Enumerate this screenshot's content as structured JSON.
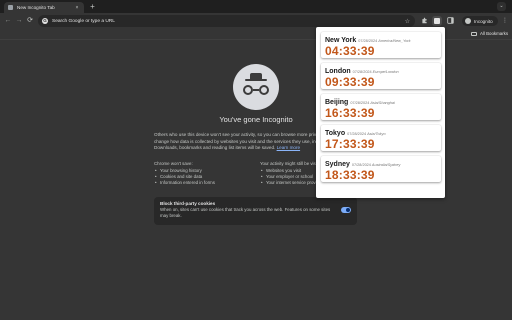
{
  "tabs": [
    {
      "title": "New Incognito Tab",
      "close": "×"
    }
  ],
  "tabstrip": {
    "new_tab": "+",
    "tab_search": "⌄"
  },
  "toolbar": {
    "back": "←",
    "forward": "→",
    "reload": "⟳",
    "omnibox_placeholder": "Search Google or type a URL",
    "google_glyph": "G",
    "star": "☆",
    "profile_label": "Incognito",
    "menu": "⋮"
  },
  "bookmarks": {
    "all_bookmarks": "All Bookmarks"
  },
  "incognito_page": {
    "heading": "You've gone Incognito",
    "intro": "Others who use this device won't see your activity, so you can browse more privately. This won't change how data is collected by websites you visit and the services they use, including Google. Downloads, bookmarks and reading list items will be saved.",
    "learn_more": "Learn more",
    "wont_save": {
      "title": "Chrome won't save:",
      "items": [
        "Your browsing history",
        "Cookies and site data",
        "Information entered in forms"
      ]
    },
    "might_be_visible": {
      "title": "Your activity might still be visible to:",
      "items": [
        "Websites you visit",
        "Your employer or school",
        "Your internet service provider"
      ]
    },
    "cookies": {
      "title": "Block third-party cookies",
      "description": "When on, sites can't use cookies that track you across the web. Features on some sites may break.",
      "enabled": true
    }
  },
  "world_clock": {
    "accent_color": "#c2571a",
    "cities": [
      {
        "name": "New York",
        "date": "07/28/2024",
        "timezone": "America/New_York",
        "time": "04:33:39"
      },
      {
        "name": "London",
        "date": "07/28/2024",
        "timezone": "Europe/London",
        "time": "09:33:39"
      },
      {
        "name": "Beijing",
        "date": "07/28/2024",
        "timezone": "Asia/Shanghai",
        "time": "16:33:39"
      },
      {
        "name": "Tokyo",
        "date": "07/28/2024",
        "timezone": "Asia/Tokyo",
        "time": "17:33:39"
      },
      {
        "name": "Sydney",
        "date": "07/28/2024",
        "timezone": "Australia/Sydney",
        "time": "18:33:39"
      }
    ]
  }
}
